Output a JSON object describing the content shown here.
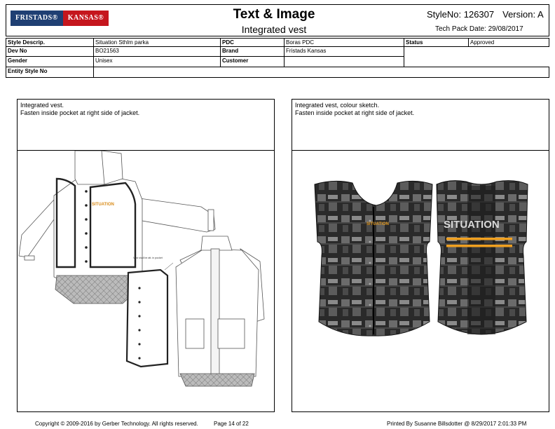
{
  "header": {
    "logo_left": "FRISTADS®",
    "logo_right": "KANSAS®",
    "title": "Text & Image",
    "subtitle": "Integrated vest",
    "style_no": "StyleNo: 126307",
    "version": "Version: A",
    "tech_pack_date": "Tech Pack Date: 29/08/2017"
  },
  "info": {
    "style_descrip_label": "Style Descrip.",
    "style_descrip_value": "Situation Sthlm parka",
    "pdc_label": "PDC",
    "pdc_value": "Boras PDC",
    "status_label": "Status",
    "status_value": "Approved",
    "dev_no_label": "Dev No",
    "dev_no_value": "BO21563",
    "brand_label": "Brand",
    "brand_value": "Fristads Kansas",
    "gender_label": "Gender",
    "gender_value": "Unisex",
    "customer_label": "Customer",
    "customer_value": "",
    "entity_style_no_label": "Entity Style No",
    "entity_style_no_value": ""
  },
  "left_panel": {
    "line1": "Integrated vest.",
    "line2": "Fasten inside pocket at right side of jacket.",
    "sketch_brand": "SITUATION",
    "sketch_note": "Vest shall be att. in pocket"
  },
  "right_panel": {
    "line1": "Integrated vest, colour sketch.",
    "line2": "Fasten inside pocket at right side of jacket.",
    "front_brand": "SITUATION",
    "back_brand": "SITUATION"
  },
  "footer": {
    "copyright": "Copyright © 2009-2016 by Gerber Technology. All rights reserved.",
    "page": "Page 14 of 22",
    "printed_by": "Printed By Susanne Billsdotter @ 8/29/2017 2:01:33 PM"
  }
}
